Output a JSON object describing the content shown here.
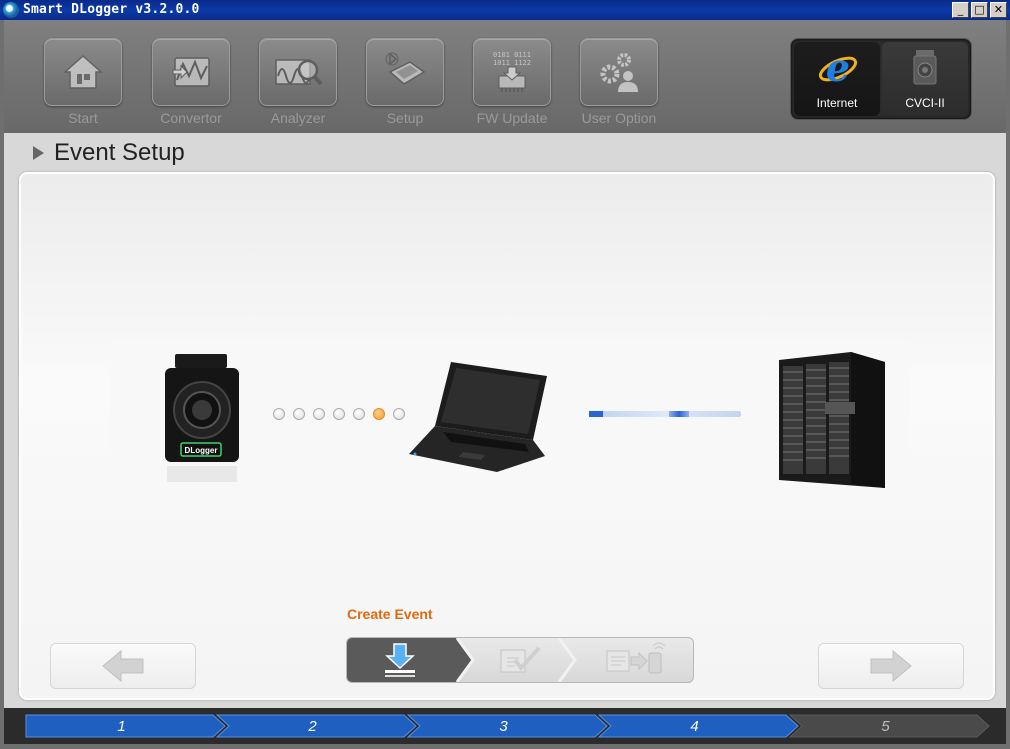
{
  "window": {
    "title": "Smart DLogger v3.2.0.0",
    "buttons": {
      "minimize": "_",
      "maximize": "□",
      "close": "✕"
    }
  },
  "toolbar": {
    "tools": [
      {
        "label": "Start",
        "icon": "home-icon"
      },
      {
        "label": "Convertor",
        "icon": "convertor-icon"
      },
      {
        "label": "Analyzer",
        "icon": "analyzer-icon"
      },
      {
        "label": "Setup",
        "icon": "setup-icon"
      },
      {
        "label": "FW Update",
        "icon": "fw-update-icon",
        "chip_text": [
          "0101 0111",
          "1011 1122"
        ]
      },
      {
        "label": "User Option",
        "icon": "user-option-icon"
      }
    ],
    "connections": [
      {
        "label": "Internet",
        "icon": "internet-explorer-icon",
        "selected": true
      },
      {
        "label": "CVCI-II",
        "icon": "cvci-device-icon",
        "selected": false
      }
    ]
  },
  "header": {
    "title": "Event Setup"
  },
  "diagram": {
    "device_label": "DLogger",
    "dots_count": 7,
    "active_dot": 6
  },
  "wizard": {
    "caption": "Create Event",
    "steps": [
      {
        "icon": "download-icon",
        "active": true
      },
      {
        "icon": "edit-check-icon",
        "active": false
      },
      {
        "icon": "transfer-device-icon",
        "active": false
      }
    ]
  },
  "progress": {
    "steps": [
      "1",
      "2",
      "3",
      "4",
      "5"
    ],
    "completed": 4
  },
  "colors": {
    "accent": "#e06a10",
    "progress_blue": "#1f5fbf",
    "title_bar": "#0b3aa8"
  }
}
